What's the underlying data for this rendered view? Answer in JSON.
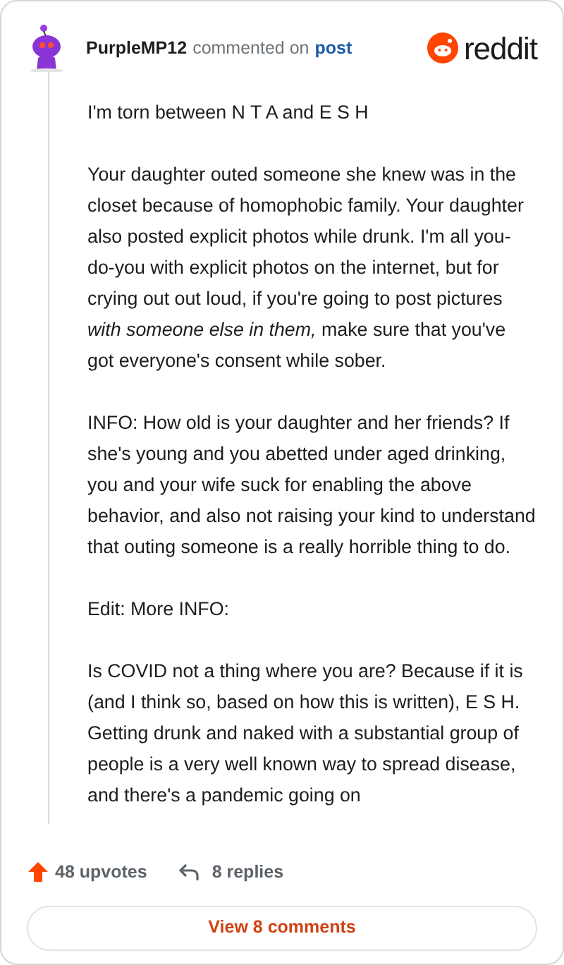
{
  "header": {
    "author": "PurpleMP12",
    "action": "commented on",
    "link": "post",
    "brand": "reddit"
  },
  "paragraphs": [
    "I'm torn between N T A and E S H",
    "Your daughter outed someone she knew was in the closet because of homophobic family. Your daughter also posted explicit photos while drunk. I'm all you-do-you with explicit photos on the internet, but for crying out out loud, if you're going to post pictures *with someone else in them,* make sure that you've got everyone's consent while sober.",
    "INFO: How old is your daughter and her friends? If she's young and you abetted under aged drinking, you and your wife suck for enabling the above behavior, and also not raising your kind to understand that outing someone is a really horrible thing to do.",
    "Edit: More INFO:",
    "Is COVID not a thing where you are? Because if it is (and I think so, based on how this is written), E S H. Getting drunk and naked with a substantial group of people is a very well known way to spread disease, and there's a pandemic going on"
  ],
  "footer": {
    "upvotes": "48 upvotes",
    "replies": "8 replies",
    "button": "View 8 comments"
  }
}
